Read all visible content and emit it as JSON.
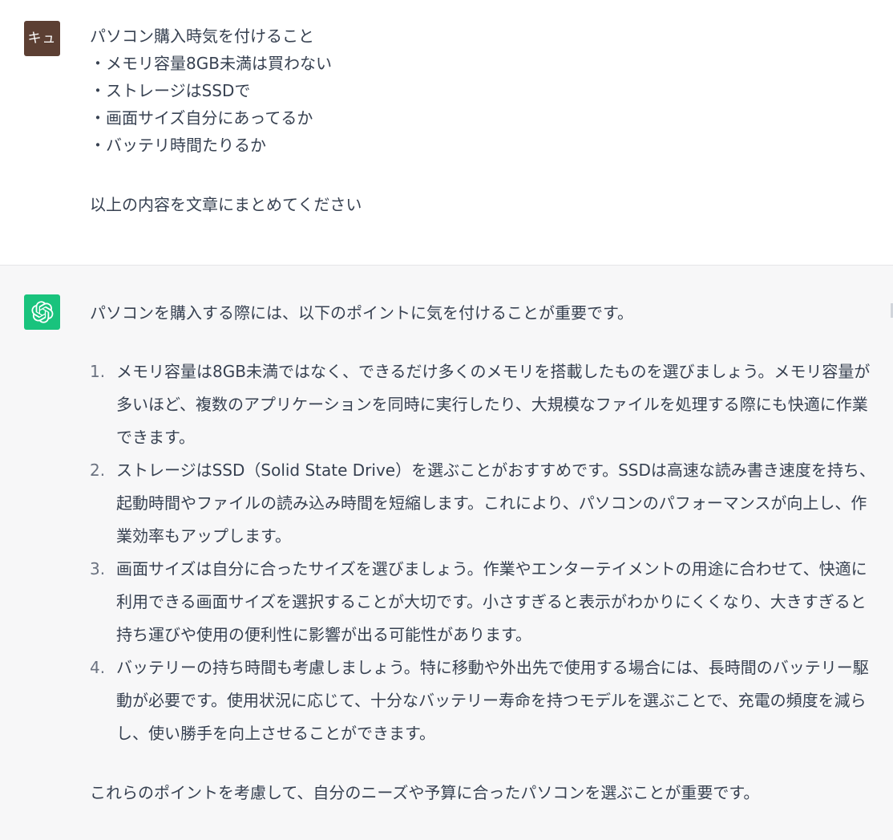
{
  "user_message": {
    "avatar_text": "キュ",
    "lines": [
      "パソコン購入時気を付けること",
      "・メモリ容量8GB未満は買わない",
      "・ストレージはSSDで",
      "・画面サイズ自分にあってるか",
      "・バッテリ時間たりるか"
    ],
    "closing": "以上の内容を文章にまとめてください"
  },
  "assistant_message": {
    "avatar_icon": "openai-logo-icon",
    "intro": "パソコンを購入する際には、以下のポイントに気を付けることが重要です。",
    "points": [
      {
        "number": "1.",
        "text": "メモリ容量は8GB未満ではなく、できるだけ多くのメモリを搭載したものを選びましょう。メモリ容量が多いほど、複数のアプリケーションを同時に実行したり、大規模なファイルを処理する際にも快適に作業できます。"
      },
      {
        "number": "2.",
        "text": "ストレージはSSD（Solid State Drive）を選ぶことがおすすめです。SSDは高速な読み書き速度を持ち、起動時間やファイルの読み込み時間を短縮します。これにより、パソコンのパフォーマンスが向上し、作業効率もアップします。"
      },
      {
        "number": "3.",
        "text": "画面サイズは自分に合ったサイズを選びましょう。作業やエンターテイメントの用途に合わせて、快適に利用できる画面サイズを選択することが大切です。小さすぎると表示がわかりにくくなり、大きすぎると持ち運びや使用の便利性に影響が出る可能性があります。"
      },
      {
        "number": "4.",
        "text": "バッテリーの持ち時間も考慮しましょう。特に移動や外出先で使用する場合には、長時間のバッテリー駆動が必要です。使用状況に応じて、十分なバッテリー寿命を持つモデルを選ぶことで、充電の頻度を減らし、使い勝手を向上させることができます。"
      }
    ],
    "outro": "これらのポイントを考慮して、自分のニーズや予算に合ったパソコンを選ぶことが重要です。"
  },
  "colors": {
    "user_avatar_bg": "#5c3f33",
    "bot_avatar_bg": "#19c37d",
    "assistant_bg": "#f7f7f8",
    "text": "#374151"
  }
}
